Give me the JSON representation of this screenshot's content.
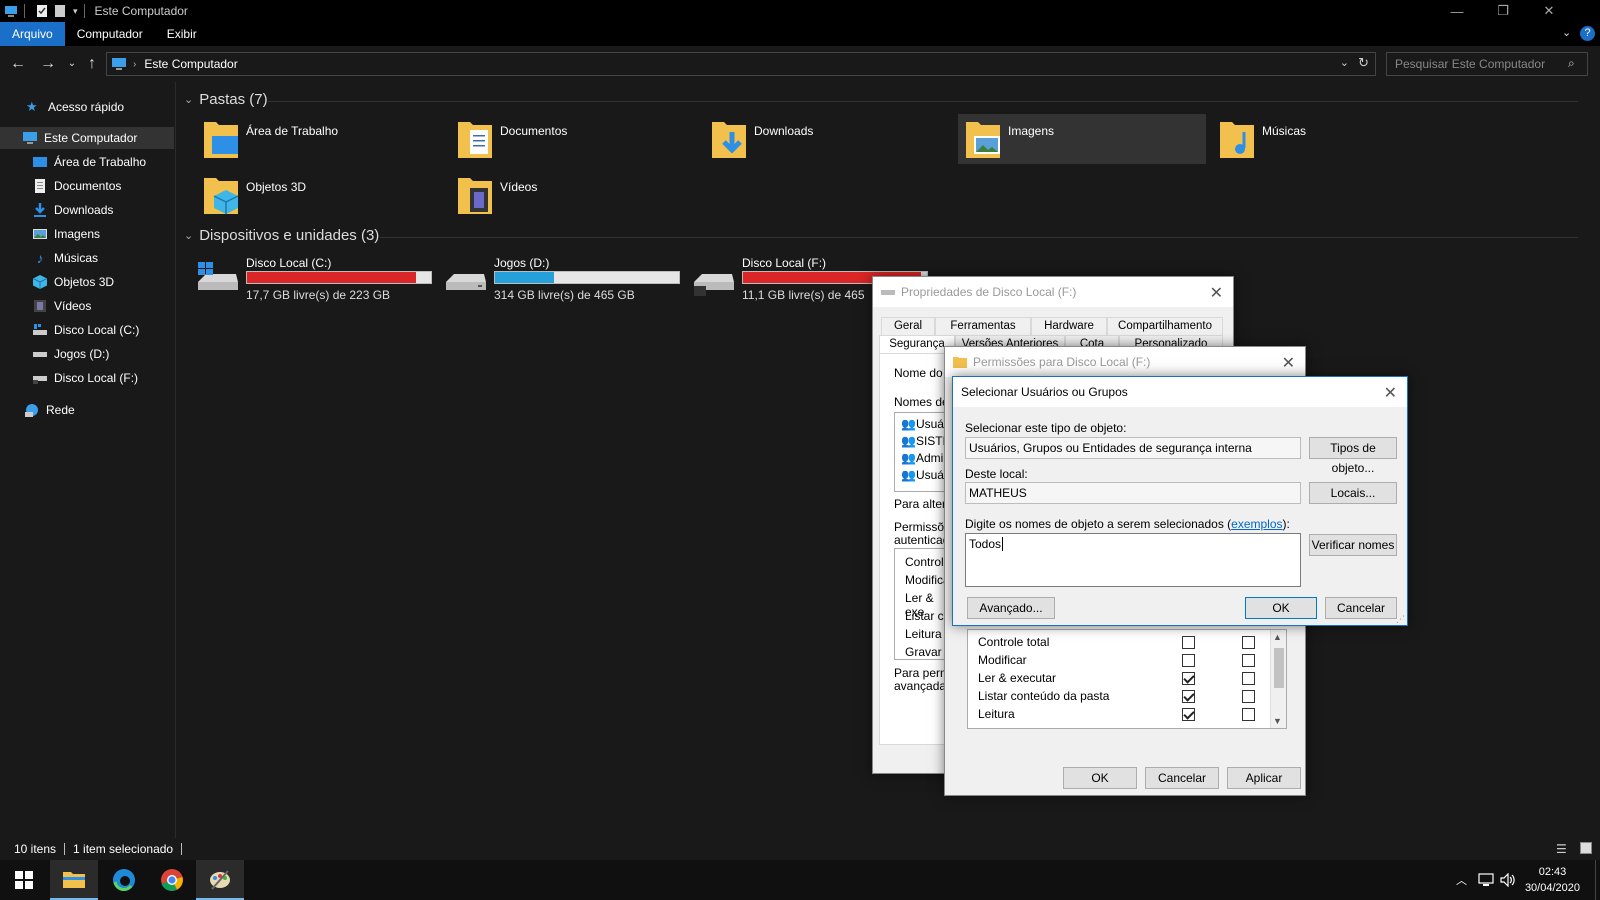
{
  "window": {
    "title": "Este Computador",
    "controls": {
      "minimize": "—",
      "maximize": "❐",
      "close": "✕"
    }
  },
  "ribbon": {
    "tabs": [
      "Arquivo",
      "Computador",
      "Exibir"
    ],
    "help": "?"
  },
  "address": {
    "path": "Este Computador",
    "search_placeholder": "Pesquisar Este Computador"
  },
  "sidebar": {
    "quick_access": "Acesso rápido",
    "this_pc": "Este Computador",
    "items": [
      "Área de Trabalho",
      "Documentos",
      "Downloads",
      "Imagens",
      "Músicas",
      "Objetos 3D",
      "Vídeos",
      "Disco Local (C:)",
      "Jogos (D:)",
      "Disco Local (F:)"
    ],
    "network": "Rede"
  },
  "folders": {
    "header": "Pastas (7)",
    "items": [
      "Área de Trabalho",
      "Documentos",
      "Downloads",
      "Imagens",
      "Músicas",
      "Objetos 3D",
      "Vídeos"
    ]
  },
  "devices": {
    "header": "Dispositivos e unidades (3)",
    "items": [
      {
        "name": "Disco Local (C:)",
        "free": "17,7 GB livre(s) de 223 GB",
        "used_fraction": 0.92,
        "color": "#da2626"
      },
      {
        "name": "Jogos (D:)",
        "free": "314 GB livre(s) de 465 GB",
        "used_fraction": 0.32,
        "color": "#26a0da"
      },
      {
        "name": "Disco Local (F:)",
        "free": "11,1 GB livre(s) de 465",
        "used_fraction": 0.97,
        "color": "#da2626"
      }
    ]
  },
  "status": {
    "count": "10 itens",
    "selected": "1 item selecionado"
  },
  "taskbar": {
    "time": "02:43",
    "date": "30/04/2020"
  },
  "props_dialog": {
    "title": "Propriedades de Disco Local (F:)",
    "tabs_row1": [
      "Geral",
      "Ferramentas",
      "Hardware",
      "Compartilhamento"
    ],
    "tabs_row2": [
      "Segurança",
      "Versões Anteriores",
      "Cota",
      "Personalizado"
    ],
    "object_label": "Nome do o",
    "groups_label": "Nomes de",
    "group_items": [
      "Usuá",
      "SISTE",
      "Admin",
      "Usuá"
    ],
    "change_label": "Para altera",
    "perms_label_1": "Permissões",
    "perms_label_2": "autenticad",
    "perm_items": [
      "Controle",
      "Modifica",
      "Ler & exe",
      "Listar co",
      "Leitura",
      "Gravar"
    ],
    "adv_label_1": "Para permi",
    "adv_label_2": "avançadas"
  },
  "perm_dialog": {
    "title": "Permissões para Disco Local (F:)",
    "rows": [
      {
        "label": "Controle total",
        "allow": false,
        "deny": false
      },
      {
        "label": "Modificar",
        "allow": false,
        "deny": false
      },
      {
        "label": "Ler & executar",
        "allow": true,
        "deny": false
      },
      {
        "label": "Listar conteúdo da pasta",
        "allow": true,
        "deny": false
      },
      {
        "label": "Leitura",
        "allow": true,
        "deny": false
      }
    ],
    "ok": "OK",
    "cancel": "Cancelar",
    "apply": "Aplicar"
  },
  "select_dialog": {
    "title": "Selecionar Usuários ou Grupos",
    "type_label": "Selecionar este tipo de objeto:",
    "type_value": "Usuários, Grupos ou Entidades de segurança interna",
    "type_button": "Tipos de objeto...",
    "location_label": "Deste local:",
    "location_value": "MATHEUS",
    "location_button": "Locais...",
    "names_label_pre": "Digite os nomes de objeto a serem selecionados (",
    "names_label_link": "exemplos",
    "names_label_post": "):",
    "names_value": "Todos",
    "check_button": "Verificar nomes",
    "advanced_button": "Avançado...",
    "ok": "OK",
    "cancel": "Cancelar"
  }
}
